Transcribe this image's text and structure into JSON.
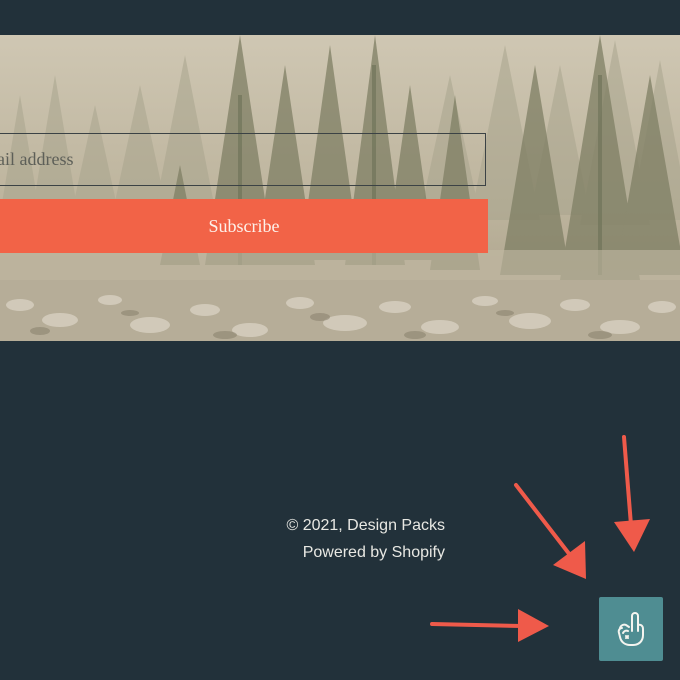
{
  "newsletter": {
    "email_placeholder": "ail address",
    "subscribe_label": "Subscribe"
  },
  "footer": {
    "copyright": "© 2021, Design Packs",
    "powered_by": "Powered by Shopify"
  },
  "widgets": {
    "accessibility_icon": "hand-pointing-up-icon"
  },
  "colors": {
    "background": "#22313a",
    "button": "#f26347",
    "widget": "#4f8d92",
    "annotation_arrow": "#ef5a4a"
  }
}
